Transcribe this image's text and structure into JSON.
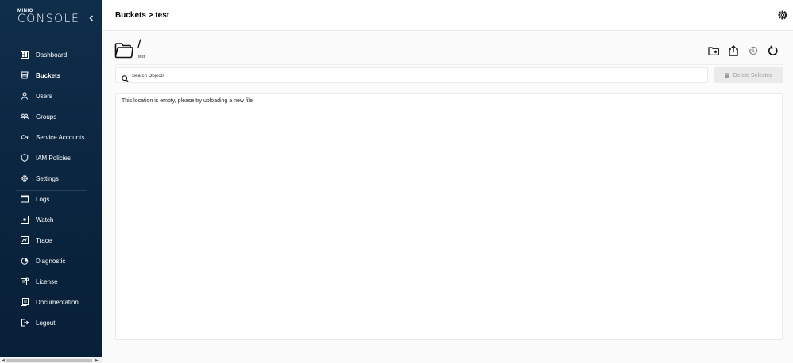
{
  "logo": {
    "small": "MINIO",
    "big": "CONSOLE"
  },
  "sidebar": {
    "items": [
      {
        "label": "Dashboard",
        "icon": "dashboard-icon"
      },
      {
        "label": "Buckets",
        "icon": "bucket-icon",
        "active": true
      },
      {
        "label": "Users",
        "icon": "user-icon"
      },
      {
        "label": "Groups",
        "icon": "groups-icon"
      },
      {
        "label": "Service Accounts",
        "icon": "service-accounts-icon"
      },
      {
        "label": "IAM Policies",
        "icon": "shield-icon"
      },
      {
        "label": "Settings",
        "icon": "gear-icon"
      },
      {
        "label": "Logs",
        "icon": "logs-icon"
      },
      {
        "label": "Watch",
        "icon": "watch-icon"
      },
      {
        "label": "Trace",
        "icon": "trace-icon"
      },
      {
        "label": "Diagnostic",
        "icon": "diagnostic-icon"
      },
      {
        "label": "License",
        "icon": "license-icon"
      },
      {
        "label": "Documentation",
        "icon": "documentation-icon"
      },
      {
        "label": "Logout",
        "icon": "logout-icon"
      }
    ]
  },
  "header": {
    "title": "Buckets > test"
  },
  "browser": {
    "path": "/",
    "bucket": "test",
    "search_placeholder": "Search Objects",
    "delete_label": "Delete Selected",
    "empty_message": "This location is empty, please try uploading a new file"
  },
  "colors": {
    "sidebar_bg": "#0b2742",
    "disabled_button_bg": "#eaeaea",
    "disabled_text": "#9a9a9a"
  }
}
